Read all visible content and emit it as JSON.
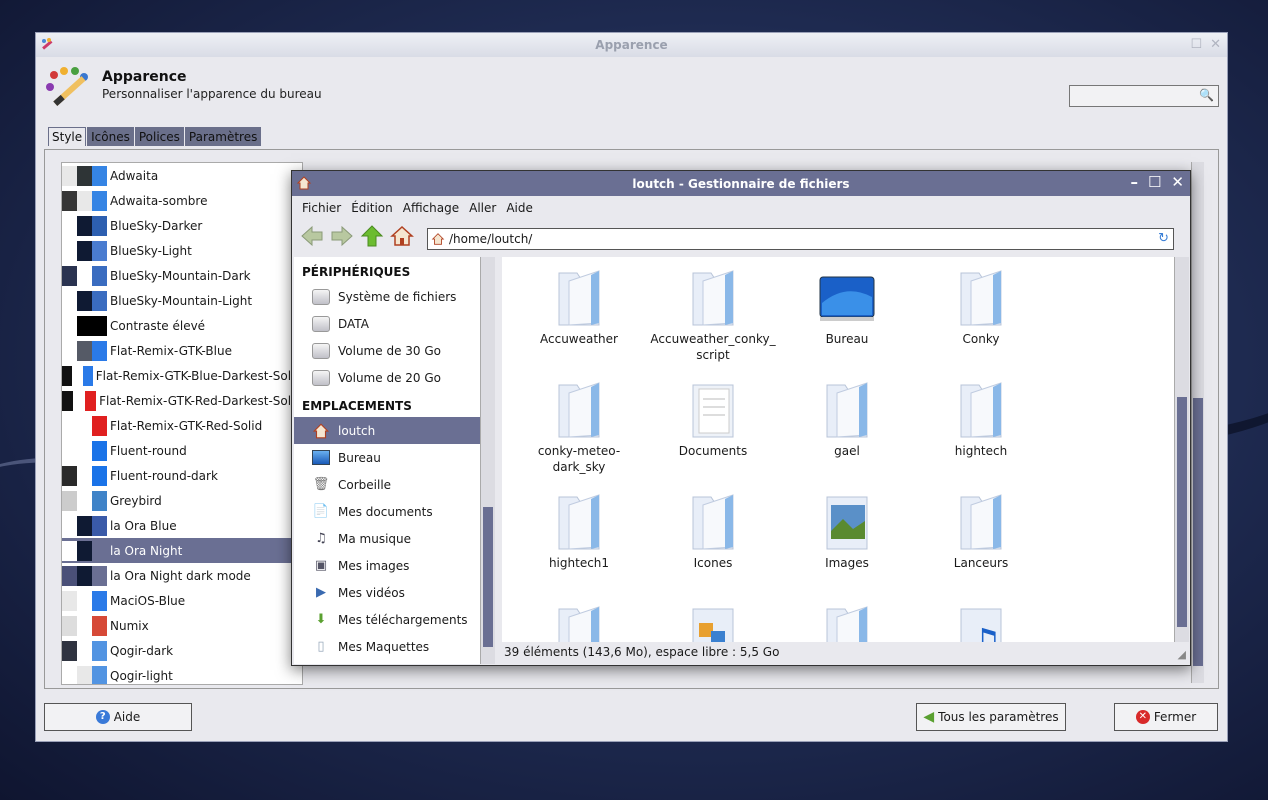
{
  "window": {
    "title": "Apparence"
  },
  "header": {
    "title": "Apparence",
    "subtitle": "Personnaliser l'apparence du bureau"
  },
  "search": {
    "placeholder": ""
  },
  "tabs": [
    {
      "label": "Style"
    },
    {
      "label": "Icônes"
    },
    {
      "label": "Polices"
    },
    {
      "label": "Paramètres"
    }
  ],
  "themes": [
    {
      "name": "Adwaita",
      "c1": "#e8e8e8",
      "c2": "#2e3436",
      "c3": "#3584e4"
    },
    {
      "name": "Adwaita-sombre",
      "c1": "#353535",
      "c2": "#e8e8e8",
      "c3": "#3584e4"
    },
    {
      "name": "BlueSky-Darker",
      "c1": "#ffffff",
      "c2": "#0f1a33",
      "c3": "#2d5fb0"
    },
    {
      "name": "BlueSky-Light",
      "c1": "#ffffff",
      "c2": "#0f1a33",
      "c3": "#4a7cd0"
    },
    {
      "name": "BlueSky-Mountain-Dark",
      "c1": "#2a3350",
      "c2": "#ffffff",
      "c3": "#3a6cc0"
    },
    {
      "name": "BlueSky-Mountain-Light",
      "c1": "#ffffff",
      "c2": "#0f1a33",
      "c3": "#3a6cc0"
    },
    {
      "name": "Contraste élevé",
      "c1": "#ffffff",
      "c2": "#000000",
      "c3": "#000000"
    },
    {
      "name": "Flat-Remix-GTK-Blue",
      "c1": "#ffffff",
      "c2": "#555a66",
      "c3": "#2a7ae8"
    },
    {
      "name": "Flat-Remix-GTK-Blue-Darkest-Solid",
      "c1": "#111111",
      "c2": "#ffffff",
      "c3": "#2a7ae8"
    },
    {
      "name": "Flat-Remix-GTK-Red-Darkest-Solid",
      "c1": "#111111",
      "c2": "#ffffff",
      "c3": "#e02020"
    },
    {
      "name": "Flat-Remix-GTK-Red-Solid",
      "c1": "#ffffff",
      "c2": "#ffffff",
      "c3": "#e02020"
    },
    {
      "name": "Fluent-round",
      "c1": "#ffffff",
      "c2": "#ffffff",
      "c3": "#1a73e8"
    },
    {
      "name": "Fluent-round-dark",
      "c1": "#2a2a2a",
      "c2": "#ffffff",
      "c3": "#1a73e8"
    },
    {
      "name": "Greybird",
      "c1": "#cccccc",
      "c2": "#ffffff",
      "c3": "#3f83c8"
    },
    {
      "name": "la Ora Blue",
      "c1": "#ffffff",
      "c2": "#0f1a33",
      "c3": "#3a5aa8"
    },
    {
      "name": "la Ora Night",
      "c1": "#ffffff",
      "c2": "#0f1a33",
      "c3": "#6a6f93",
      "selected": true
    },
    {
      "name": "la Ora Night dark mode",
      "c1": "#4a5078",
      "c2": "#0f1a33",
      "c3": "#6a6f93"
    },
    {
      "name": "MaciOS-Blue",
      "c1": "#e8e8e8",
      "c2": "#ffffff",
      "c3": "#2a7ae8"
    },
    {
      "name": "Numix",
      "c1": "#dddddd",
      "c2": "#ffffff",
      "c3": "#d64937"
    },
    {
      "name": "Qogir-dark",
      "c1": "#2f3340",
      "c2": "#ffffff",
      "c3": "#5294e2"
    },
    {
      "name": "Qogir-light",
      "c1": "#ffffff",
      "c2": "#e8e8e8",
      "c3": "#5294e2"
    }
  ],
  "buttons": {
    "help": "Aide",
    "all_settings": "Tous les paramètres",
    "close": "Fermer"
  },
  "filemanager": {
    "title": "loutch - Gestionnaire de fichiers",
    "menus": [
      "Fichier",
      "Édition",
      "Affichage",
      "Aller",
      "Aide"
    ],
    "path": "/home/loutch/",
    "sections": {
      "devices": "PÉRIPHÉRIQUES",
      "places": "EMPLACEMENTS"
    },
    "devices": [
      {
        "label": "Système de fichiers",
        "icon": "drive-icon"
      },
      {
        "label": "DATA",
        "icon": "drive-icon"
      },
      {
        "label": "Volume de 30 Go",
        "icon": "drive-icon"
      },
      {
        "label": "Volume de 20 Go",
        "icon": "drive-icon"
      }
    ],
    "places": [
      {
        "label": "loutch",
        "icon": "home-icon",
        "selected": true
      },
      {
        "label": "Bureau",
        "icon": "desktop-icon"
      },
      {
        "label": "Corbeille",
        "icon": "trash-icon"
      },
      {
        "label": "Mes documents",
        "icon": "documents-icon"
      },
      {
        "label": "Ma musique",
        "icon": "music-icon"
      },
      {
        "label": "Mes images",
        "icon": "pictures-icon"
      },
      {
        "label": "Mes vidéos",
        "icon": "videos-icon"
      },
      {
        "label": "Mes téléchargements",
        "icon": "downloads-icon"
      },
      {
        "label": "Mes Maquettes",
        "icon": "folder-icon"
      }
    ],
    "files": [
      {
        "name": "Accuweather",
        "icon": "folder"
      },
      {
        "name": "Accuweather_conky_script",
        "icon": "folder"
      },
      {
        "name": "Bureau",
        "icon": "desktop"
      },
      {
        "name": "Conky",
        "icon": "folder"
      },
      {
        "name": "conky-meteo-dark_sky",
        "icon": "folder"
      },
      {
        "name": "Documents",
        "icon": "documents"
      },
      {
        "name": "gael",
        "icon": "folder"
      },
      {
        "name": "hightech",
        "icon": "folder"
      },
      {
        "name": "hightech1",
        "icon": "folder"
      },
      {
        "name": "Icones",
        "icon": "folder"
      },
      {
        "name": "Images",
        "icon": "pictures"
      },
      {
        "name": "Lanceurs",
        "icon": "folder"
      },
      {
        "name": "",
        "icon": "folder"
      },
      {
        "name": "",
        "icon": "templates"
      },
      {
        "name": "",
        "icon": "folder"
      },
      {
        "name": "",
        "icon": "music"
      }
    ],
    "status": "39 éléments (143,6 Mo), espace libre : 5,5 Go"
  }
}
